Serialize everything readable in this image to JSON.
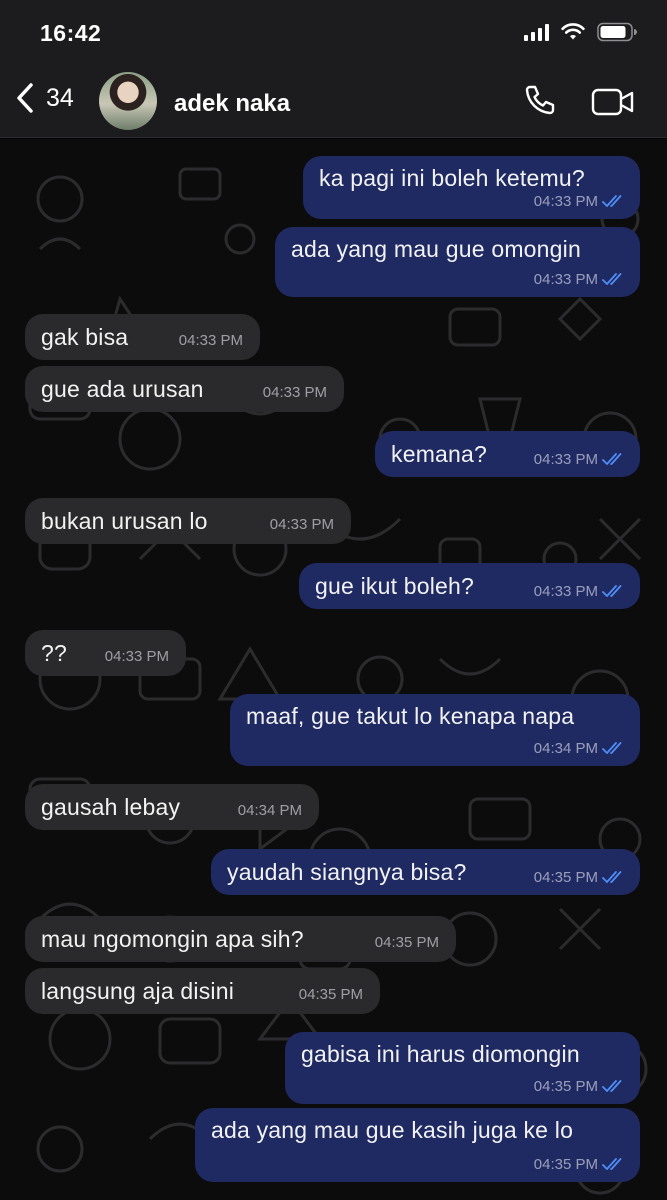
{
  "status_bar": {
    "time": "16:42"
  },
  "header": {
    "back_count": "34",
    "contact_name": "adek naka"
  },
  "messages": [
    {
      "text": "ka pagi ini boleh ketemu?",
      "time": "04:33 PM",
      "dir": "out"
    },
    {
      "text": "ada yang mau gue omongin",
      "time": "04:33 PM",
      "dir": "out"
    },
    {
      "text": "gak bisa",
      "time": "04:33 PM",
      "dir": "in"
    },
    {
      "text": "gue ada urusan",
      "time": "04:33 PM",
      "dir": "in"
    },
    {
      "text": "kemana?",
      "time": "04:33 PM",
      "dir": "out"
    },
    {
      "text": "bukan urusan lo",
      "time": "04:33 PM",
      "dir": "in"
    },
    {
      "text": "gue ikut boleh?",
      "time": "04:33 PM",
      "dir": "out"
    },
    {
      "text": "??",
      "time": "04:33 PM",
      "dir": "in"
    },
    {
      "text": "maaf, gue takut lo kenapa napa",
      "time": "04:34 PM",
      "dir": "out"
    },
    {
      "text": "gausah lebay",
      "time": "04:34 PM",
      "dir": "in"
    },
    {
      "text": "yaudah siangnya bisa?",
      "time": "04:35 PM",
      "dir": "out"
    },
    {
      "text": "mau ngomongin apa sih?",
      "time": "04:35 PM",
      "dir": "in"
    },
    {
      "text": "langsung aja disini",
      "time": "04:35 PM",
      "dir": "in"
    },
    {
      "text": "gabisa ini harus diomongin",
      "time": "04:35 PM",
      "dir": "out"
    },
    {
      "text": "ada yang mau gue kasih juga ke lo",
      "time": "04:35 PM",
      "dir": "out"
    }
  ],
  "colors": {
    "outgoing_bubble": "#1f2a63",
    "incoming_bubble": "#2a2a2c",
    "read_ticks": "#4f8ef7"
  },
  "icons": [
    "back-chevron-icon",
    "phone-icon",
    "video-camera-icon",
    "signal-icon",
    "wifi-icon",
    "battery-icon",
    "read-receipt-icon"
  ]
}
